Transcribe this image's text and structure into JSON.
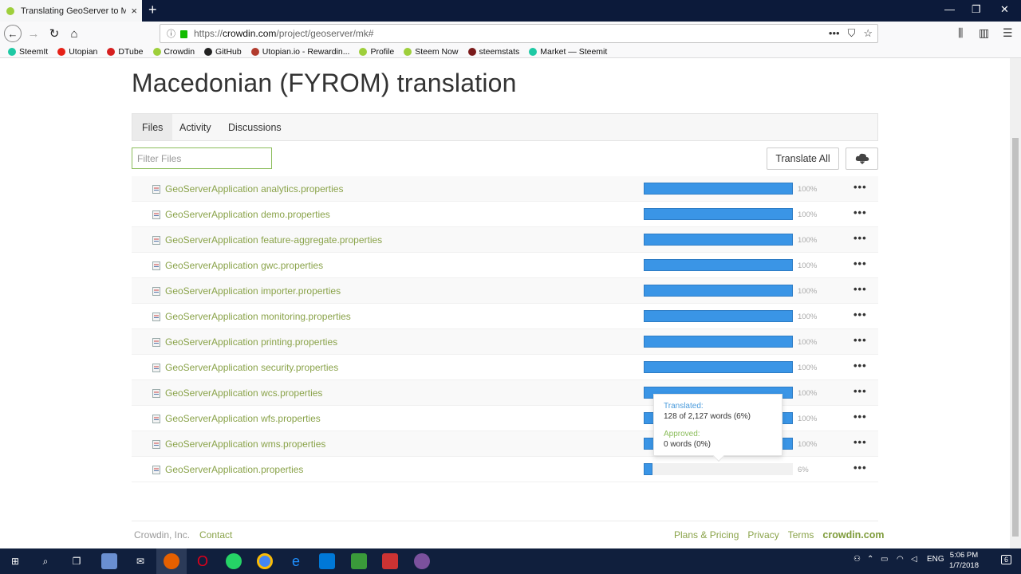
{
  "browser": {
    "tab_title": "Translating GeoServer to Maced",
    "url_prefix": "https://",
    "url_host": "crowdin.com",
    "url_path": "/project/geoserver/mk#"
  },
  "bookmarks": [
    {
      "label": "SteemIt",
      "icon": "steemit-icon",
      "color": "#1ec9a4"
    },
    {
      "label": "Utopian",
      "icon": "youtube-icon",
      "color": "#e62117"
    },
    {
      "label": "DTube",
      "icon": "dtube-icon",
      "color": "#d61f1f"
    },
    {
      "label": "Crowdin",
      "icon": "crowdin-icon",
      "color": "#9ecf3b"
    },
    {
      "label": "GitHub",
      "icon": "github-icon",
      "color": "#222222"
    },
    {
      "label": "Utopian.io - Rewardin...",
      "icon": "utopian-icon",
      "color": "#b23b2e"
    },
    {
      "label": "Profile",
      "icon": "crowdin-icon",
      "color": "#9ecf3b"
    },
    {
      "label": "Steem Now",
      "icon": "crowdin-icon",
      "color": "#9ecf3b"
    },
    {
      "label": "steemstats",
      "icon": "steemstats-icon",
      "color": "#7a1a1a"
    },
    {
      "label": "Market — Steemit",
      "icon": "steemit-icon",
      "color": "#1ec9a4"
    }
  ],
  "page": {
    "title": "Macedonian (FYROM) translation",
    "tabs": [
      "Files",
      "Activity",
      "Discussions"
    ],
    "filter_placeholder": "Filter Files",
    "translate_all_label": "Translate All"
  },
  "files": [
    {
      "name": "GeoServerApplication analytics.properties",
      "progress": 100,
      "pct_label": "100%"
    },
    {
      "name": "GeoServerApplication demo.properties",
      "progress": 100,
      "pct_label": "100%"
    },
    {
      "name": "GeoServerApplication feature-aggregate.properties",
      "progress": 100,
      "pct_label": "100%"
    },
    {
      "name": "GeoServerApplication gwc.properties",
      "progress": 100,
      "pct_label": "100%"
    },
    {
      "name": "GeoServerApplication importer.properties",
      "progress": 100,
      "pct_label": "100%"
    },
    {
      "name": "GeoServerApplication monitoring.properties",
      "progress": 100,
      "pct_label": "100%"
    },
    {
      "name": "GeoServerApplication printing.properties",
      "progress": 100,
      "pct_label": "100%"
    },
    {
      "name": "GeoServerApplication security.properties",
      "progress": 100,
      "pct_label": "100%"
    },
    {
      "name": "GeoServerApplication wcs.properties",
      "progress": 100,
      "pct_label": "100%"
    },
    {
      "name": "GeoServerApplication wfs.properties",
      "progress": 100,
      "pct_label": "100%"
    },
    {
      "name": "GeoServerApplication wms.properties",
      "progress": 100,
      "pct_label": "100%"
    },
    {
      "name": "GeoServerApplication.properties",
      "progress": 6,
      "pct_label": "6%"
    }
  ],
  "tooltip": {
    "translated_label": "Translated:",
    "translated_value": "128 of 2,127 words (6%)",
    "approved_label": "Approved:",
    "approved_value": "0 words (0%)"
  },
  "footer": {
    "company": "Crowdin, Inc.",
    "contact": "Contact",
    "pricing": "Plans & Pricing",
    "privacy": "Privacy",
    "terms": "Terms",
    "brand": "crowdin.com"
  },
  "taskbar": {
    "lang": "ENG",
    "time": "5:06 PM",
    "date": "1/7/2018",
    "notifications": "6"
  },
  "colors": {
    "progress_fill": "#3a95e6",
    "link_green": "#8aa34a"
  }
}
